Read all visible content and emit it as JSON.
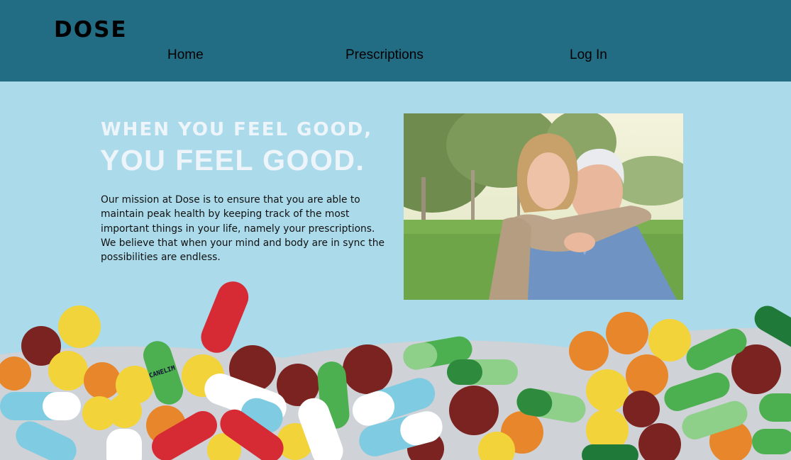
{
  "header": {
    "brand": "DOSE",
    "nav": [
      {
        "label": "Home"
      },
      {
        "label": "Prescriptions"
      },
      {
        "label": "Log In"
      }
    ],
    "background": "#226c84"
  },
  "hero": {
    "kicker": "WHEN YOU FEEL GOOD,",
    "headline": "YOU FEEL GOOD.",
    "mission": "Our mission at Dose is to ensure that you are able to maintain peak health by keeping track of the most important things in your life, namely your prescriptions. We believe that when your mind and body are in sync the possibilities are endless.",
    "background": "#abdbea",
    "text_color": "#edf5fa"
  },
  "photo": {
    "subject": "elderly couple embracing outdoors on grass"
  },
  "pills": {
    "capsule_text": "CANELIM",
    "colors": [
      "#d62a35",
      "#f3d33a",
      "#e8862c",
      "#7a2320",
      "#4caf50",
      "#7fcbe2",
      "#ffffff"
    ]
  }
}
